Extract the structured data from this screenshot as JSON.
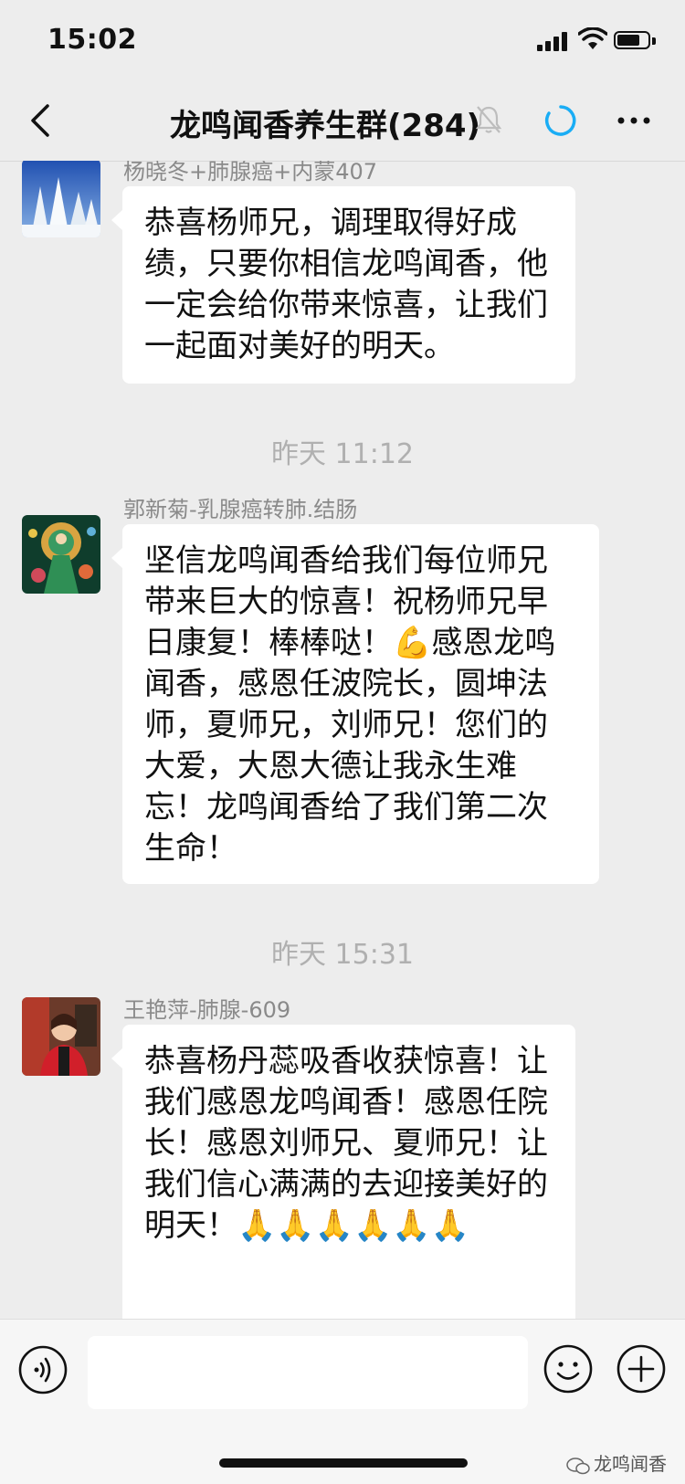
{
  "status_bar": {
    "time": "15:02"
  },
  "nav": {
    "title": "龙鸣闻香养生群(284)"
  },
  "messages": [
    {
      "sender": "杨晓冬+肺腺癌+内蒙407",
      "avatar": "snowy-forest-avatar",
      "text": "恭喜杨师兄，调理取得好成绩，只要你相信龙鸣闻香，他一定会给你带来惊喜，让我们一起面对美好的明天。"
    },
    {
      "timestamp": "昨天 11:12"
    },
    {
      "sender": "郭新菊-乳腺癌转肺.结肠",
      "avatar": "green-tara-avatar",
      "text": "坚信龙鸣闻香给我们每位师兄带来巨大的惊喜！祝杨师兄早日康复！棒棒哒！💪感恩龙鸣闻香，感恩任波院长，圆坤法师，夏师兄，刘师兄！您们的大爱，大恩大德让我永生难忘！龙鸣闻香给了我们第二次生命！"
    },
    {
      "timestamp": "昨天 15:31"
    },
    {
      "sender": "王艳萍-肺腺-609",
      "avatar": "woman-portrait-avatar",
      "text": "恭喜杨丹蕊吸香收获惊喜！让我们感恩龙鸣闻香！感恩任院长！感恩刘师兄、夏师兄！让我们信心满满的去迎接美好的明天！🙏🙏🙏🙏🙏🙏"
    }
  ],
  "watermark": "龙鸣闻香",
  "colors": {
    "background": "#ededed",
    "bubble": "#ffffff",
    "accent": "#1aadf5"
  }
}
